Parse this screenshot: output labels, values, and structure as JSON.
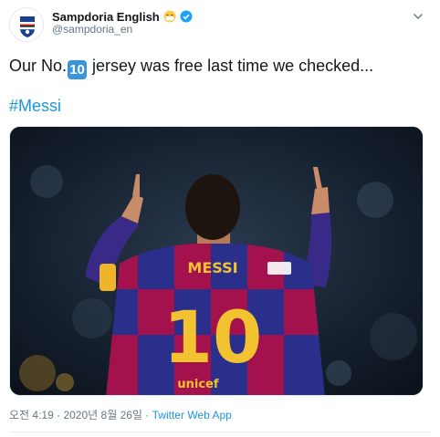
{
  "author": {
    "display_name": "Sampdoria English",
    "handle": "@sampdoria_en",
    "emoji": "grinning-face-with-mask-emoji",
    "verified_icon": "verified-badge-icon"
  },
  "tweet": {
    "text_before": "Our No.",
    "keycap_number": "10",
    "text_after": " jersey was free last time we checked...",
    "hashtag": "#Messi"
  },
  "media": {
    "kind": "photo",
    "jersey_name": "MESSI",
    "jersey_number": "10",
    "sponsor": "unicef"
  },
  "meta": {
    "time": "오전 4:19",
    "separator": " · ",
    "date": "2020년 8월 26일",
    "source": "Twitter Web App"
  },
  "colors": {
    "accent": "#1b95e0",
    "secondary_text": "#657786",
    "verified": "#1da1f2"
  }
}
